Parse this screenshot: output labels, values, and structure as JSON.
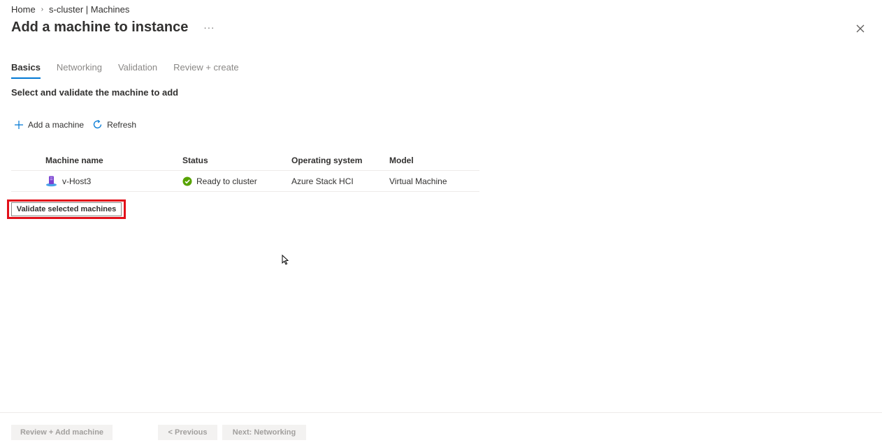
{
  "breadcrumb": {
    "home": "Home",
    "current": "s-cluster | Machines"
  },
  "page": {
    "title": "Add a machine to instance",
    "more": "···"
  },
  "tabs": [
    {
      "label": "Basics",
      "active": true
    },
    {
      "label": "Networking",
      "active": false
    },
    {
      "label": "Validation",
      "active": false
    },
    {
      "label": "Review + create",
      "active": false
    }
  ],
  "section_heading": "Select and validate the machine to add",
  "toolbar": {
    "add_label": "Add a machine",
    "refresh_label": "Refresh"
  },
  "table": {
    "headers": [
      "Machine name",
      "Status",
      "Operating system",
      "Model"
    ],
    "rows": [
      {
        "name": "v-Host3",
        "status": "Ready to cluster",
        "os": "Azure Stack HCI",
        "model": "Virtual Machine"
      }
    ]
  },
  "validate_button": "Validate selected machines",
  "footer": {
    "review_add": "Review + Add machine",
    "previous": "< Previous",
    "next": "Next: Networking"
  },
  "colors": {
    "accent": "#0078d4",
    "success": "#57a300",
    "highlight": "#e2101a",
    "machine_icon": "#7a42d1"
  }
}
